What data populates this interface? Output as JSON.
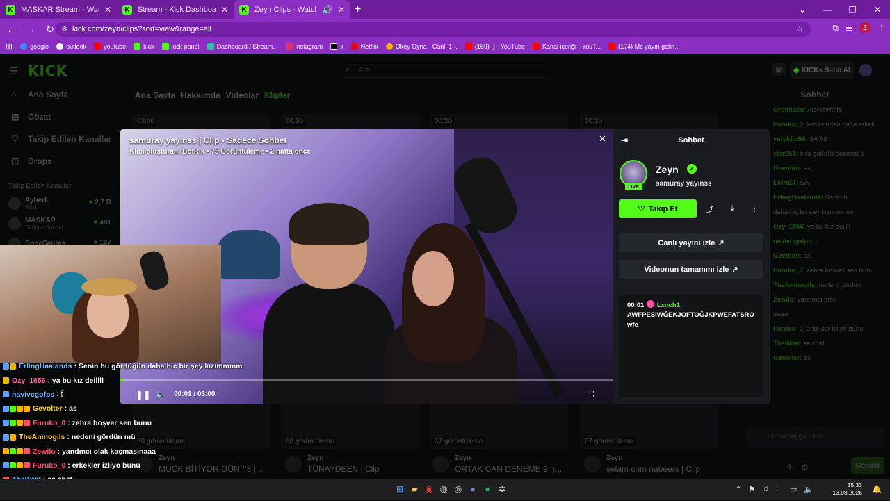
{
  "browser": {
    "tabs": [
      {
        "title": "MASKAR Stream - Watch Live o",
        "active": false
      },
      {
        "title": "Stream - Kick Dashboard",
        "active": false
      },
      {
        "title": "Zeyn Clips - Watch Live on",
        "active": true
      }
    ],
    "url": "kick.com/zeyn/clips?sort=view&range=all",
    "profile_initial": "Z",
    "bookmarks": [
      {
        "label": "google",
        "color": "#4285f4"
      },
      {
        "label": "outlook",
        "color": "#ffffff"
      },
      {
        "label": "youtube",
        "color": "#ff0000"
      },
      {
        "label": "kick",
        "color": "#53fc18"
      },
      {
        "label": "kick panel",
        "color": "#53fc18"
      },
      {
        "label": "Dashboard / Stream...",
        "color": "#2ec4a0"
      },
      {
        "label": "instagram",
        "color": "#e1306c"
      },
      {
        "label": "x",
        "color": "#000000"
      },
      {
        "label": "Netflix",
        "color": "#e50914"
      },
      {
        "label": "Okey Oyna - Canlı 1...",
        "color": "#f2b400"
      },
      {
        "label": "(159) ;) - YouTube",
        "color": "#ff0000"
      },
      {
        "label": "Kanal içeriği - YouT...",
        "color": "#ff0000"
      },
      {
        "label": "(174) Mc yayın gelin...",
        "color": "#ff0000"
      }
    ]
  },
  "kick": {
    "search_placeholder": "Ara",
    "kicks_button": "KICKs Satın Al",
    "nav": [
      {
        "label": "Ana Sayfa",
        "icon": "home-icon"
      },
      {
        "label": "Gözat",
        "icon": "browse-icon"
      },
      {
        "label": "Takip Edilen Kanallar",
        "icon": "heart-icon"
      },
      {
        "label": "Drops",
        "icon": "drops-icon"
      }
    ],
    "followed_title": "Takip Edilen Kanallar",
    "followed": [
      {
        "name": "Ayberk",
        "sub": "Rust",
        "viewers": "2,7 B"
      },
      {
        "name": "MASKAR",
        "sub": "Sadece Sohbet",
        "viewers": "481"
      },
      {
        "name": "BoneSaures",
        "sub": "",
        "viewers": "137"
      }
    ],
    "channel_tabs": [
      "Ana Sayfa",
      "Hakkımda",
      "Videolar",
      "Klipler"
    ],
    "clip_durations": [
      "03:00",
      "00:30",
      "00:30",
      "00:30"
    ],
    "clip_cards": [
      {
        "views": "69 görüntüleme",
        "channel": "Zeyn",
        "title": "MUCK BİTİYOR GÜN #3 | ..."
      },
      {
        "views": "68 görüntüleme",
        "channel": "Zeyn",
        "title": "TÜNAYDEEN | Clip"
      },
      {
        "views": "67 görüntüleme",
        "channel": "Zeyn",
        "title": "ORTAK CAN DENEME 9 ;)..."
      },
      {
        "views": "67 görüntüleme",
        "channel": "Zeyn",
        "title": "selam cnm nabeers | Clip"
      }
    ],
    "side_chat": {
      "title": "Sohbet",
      "lines": [
        {
          "user": "Orendasu",
          "text": "AloNeWolfo"
        },
        {
          "user": "Furuko_0",
          "text": "kocasından daha erkek"
        },
        {
          "user": "yefyldm56",
          "text": "SA AS"
        },
        {
          "user": "ekir251",
          "text": "bıra gobekli dobiocu o"
        },
        {
          "user": "Gevolter",
          "text": "as"
        },
        {
          "user": "EMNET",
          "text": "SA"
        },
        {
          "user": "ErlingHaalands",
          "text": "Senin bu"
        },
        {
          "user": "",
          "text": "daha hiç bir şey kızımmmm"
        },
        {
          "user": "Ozy_1856",
          "text": "ya bu kız deillll"
        },
        {
          "user": "navivcgofps",
          "text": "🕯"
        },
        {
          "user": "Gevolter",
          "text": "as"
        },
        {
          "user": "Furuko_0",
          "text": "zehra boşver sen bunu"
        },
        {
          "user": "TheAninogils",
          "text": "nedeni gördün"
        },
        {
          "user": "Zewilo",
          "text": "yandmcı olak"
        },
        {
          "user": "",
          "text": "aaaa"
        },
        {
          "user": "Furuko_0",
          "text": "erkekler izliyo bunu"
        },
        {
          "user": "TheWrat",
          "text": "sa chat"
        },
        {
          "user": "Gevolter",
          "text": "as"
        }
      ],
      "input_placeholder": "Bir mesaj gönderin",
      "points": "0",
      "send_label": "Gönder"
    }
  },
  "modal": {
    "title": "samuray yayınss | Clip • Sadece Sohbet",
    "subtitle": "Klibi oluşturan: BotRix • 75 Görüntüleme • 2 hafta önce",
    "timecode": "00:01 / 03:00",
    "progress": 0.005,
    "panel_title": "Sohbet",
    "channel_name": "Zeyn",
    "channel_subtitle": "samuray yayınss",
    "live_label": "LIVE",
    "follow_label": "Takip Et",
    "watch_live_label": "Canlı yayını izle",
    "watch_full_label": "Videonun tamamını izle",
    "chat": {
      "time": "00:01",
      "user": "Lxnch1:",
      "message": "AWFPESIWĞEKJOFTOĞJKPWEFATSRO wfe"
    }
  },
  "overlay_chat": [
    {
      "user": "ErlingHaalands",
      "color": "#7ab8ff",
      "text": ": Senin bu gördüğün daha hiç bir şey kızımmmm"
    },
    {
      "user": "Ozy_1856",
      "color": "#ff6fa9",
      "text": ": ya bu kız deillll"
    },
    {
      "user": "navivcgofps",
      "color": "#7ab8ff",
      "text": ": 🕯"
    },
    {
      "user": "Gevolter",
      "color": "#ffd23f",
      "text": ": as"
    },
    {
      "user": "Furuko_0",
      "color": "#ff4f6a",
      "text": ": zehra boşver sen bunu"
    },
    {
      "user": "TheAninogils",
      "color": "#ffd23f",
      "text": ": nedeni gördün mü"
    },
    {
      "user": "Zewilo",
      "color": "#ff4f6a",
      "text": ": yandmcı olak kaçmasınaaa"
    },
    {
      "user": "Furuko_0",
      "color": "#ff4f6a",
      "text": ": erkekler izliyo bunu"
    },
    {
      "user": "TheWrat",
      "color": "#7ab8ff",
      "text": ": sa chat"
    },
    {
      "user": "Gevolter",
      "color": "#ffd23f",
      "text": ": as"
    }
  ],
  "taskbar": {
    "time": "15:33",
    "date": "13.08.2026"
  }
}
